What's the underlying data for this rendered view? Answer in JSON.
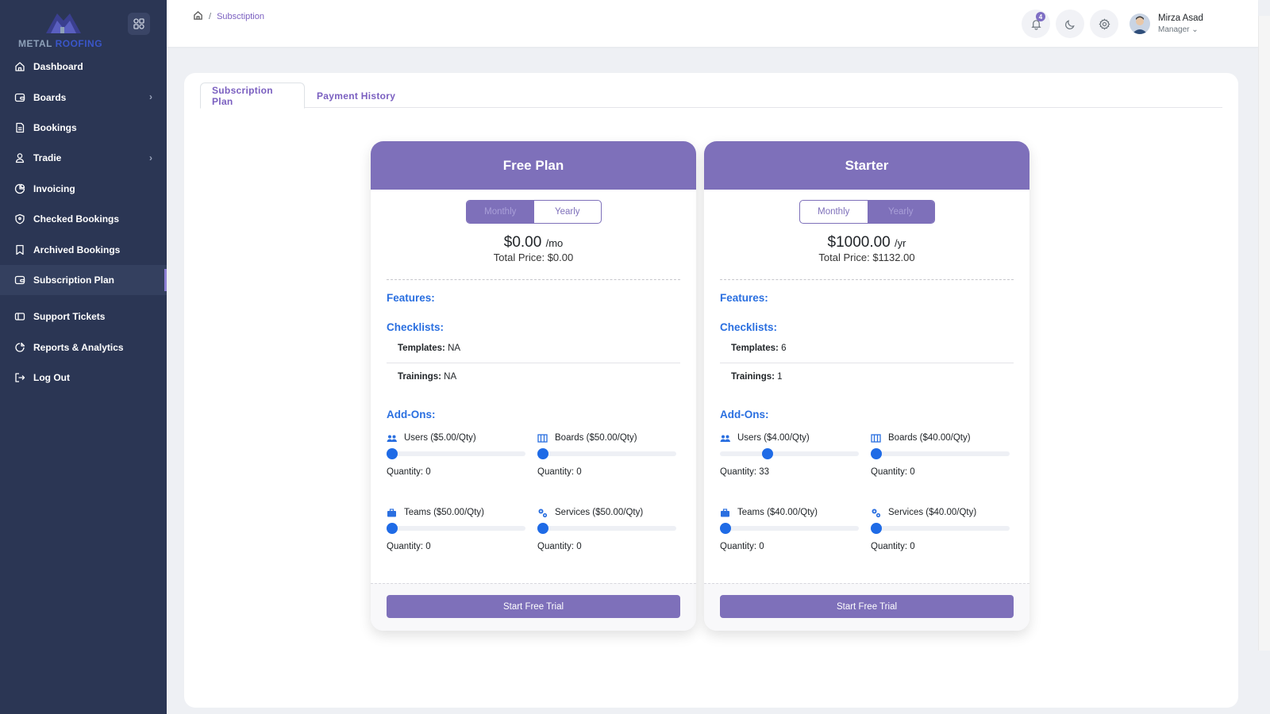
{
  "brand": {
    "logo_text_1": "METAL ",
    "logo_text_2": "ROOFING"
  },
  "sidebar": {
    "items": [
      {
        "label": "Dashboard",
        "icon": "home-icon"
      },
      {
        "label": "Boards",
        "icon": "wallet-icon",
        "chevron": true
      },
      {
        "label": "Bookings",
        "icon": "document-icon"
      },
      {
        "label": "Tradie",
        "icon": "user-icon",
        "chevron": true
      },
      {
        "label": "Invoicing",
        "icon": "pie-chart-icon"
      },
      {
        "label": "Checked Bookings",
        "icon": "shield-icon"
      },
      {
        "label": "Archived Bookings",
        "icon": "bookmark-icon"
      },
      {
        "label": "Subscription Plan",
        "icon": "wallet-icon",
        "active": true
      },
      {
        "label": "Support Tickets",
        "icon": "ticket-icon"
      },
      {
        "label": "Reports & Analytics",
        "icon": "analytics-icon"
      },
      {
        "label": "Log Out",
        "icon": "logout-icon"
      }
    ]
  },
  "header": {
    "breadcrumb_current": "Subsctiption",
    "breadcrumb_sep": "/",
    "notification_count": "4",
    "user_name": "Mirza Asad",
    "user_role": "Manager"
  },
  "tabs": {
    "subscription": "Subscription Plan",
    "payment": "Payment History"
  },
  "plans": [
    {
      "name": "Free Plan",
      "toggle_monthly": "Monthly",
      "toggle_yearly": "Yearly",
      "selected_period": "Monthly",
      "price": "$0.00",
      "per": "/mo",
      "total_label": "Total Price:",
      "total": "$0.00",
      "features_label": "Features:",
      "checklists_label": "Checklists:",
      "templates_label": "Templates:",
      "templates": "NA",
      "trainings_label": "Trainings:",
      "trainings": "NA",
      "addons_label": "Add-Ons:",
      "addons": [
        {
          "label": "Users ($5.00/Qty)",
          "icon": "users-icon",
          "quantity_label": "Quantity:",
          "quantity": "0",
          "slider_fraction": 0
        },
        {
          "label": "Boards ($50.00/Qty)",
          "icon": "board-icon",
          "quantity_label": "Quantity:",
          "quantity": "0",
          "slider_fraction": 0
        },
        {
          "label": "Teams ($50.00/Qty)",
          "icon": "briefcase-icon",
          "quantity_label": "Quantity:",
          "quantity": "0",
          "slider_fraction": 0
        },
        {
          "label": "Services ($50.00/Qty)",
          "icon": "gears-icon",
          "quantity_label": "Quantity:",
          "quantity": "0",
          "slider_fraction": 0
        }
      ],
      "cta": "Start Free Trial"
    },
    {
      "name": "Starter",
      "toggle_monthly": "Monthly",
      "toggle_yearly": "Yearly",
      "selected_period": "Yearly",
      "price": "$1000.00",
      "per": "/yr",
      "total_label": "Total Price:",
      "total": "$1132.00",
      "features_label": "Features:",
      "checklists_label": "Checklists:",
      "templates_label": "Templates:",
      "templates": "6",
      "trainings_label": "Trainings:",
      "trainings": "1",
      "addons_label": "Add-Ons:",
      "addons": [
        {
          "label": "Users ($4.00/Qty)",
          "icon": "users-icon",
          "quantity_label": "Quantity:",
          "quantity": "33",
          "slider_fraction": 0.33
        },
        {
          "label": "Boards ($40.00/Qty)",
          "icon": "board-icon",
          "quantity_label": "Quantity:",
          "quantity": "0",
          "slider_fraction": 0
        },
        {
          "label": "Teams ($40.00/Qty)",
          "icon": "briefcase-icon",
          "quantity_label": "Quantity:",
          "quantity": "0",
          "slider_fraction": 0
        },
        {
          "label": "Services ($40.00/Qty)",
          "icon": "gears-icon",
          "quantity_label": "Quantity:",
          "quantity": "0",
          "slider_fraction": 0
        }
      ],
      "cta": "Start Free Trial"
    }
  ],
  "colors": {
    "sidebar": "#2b3654",
    "accent": "#7e70ba",
    "link_blue": "#2a6fe0",
    "slider_blue": "#1f6be6"
  }
}
